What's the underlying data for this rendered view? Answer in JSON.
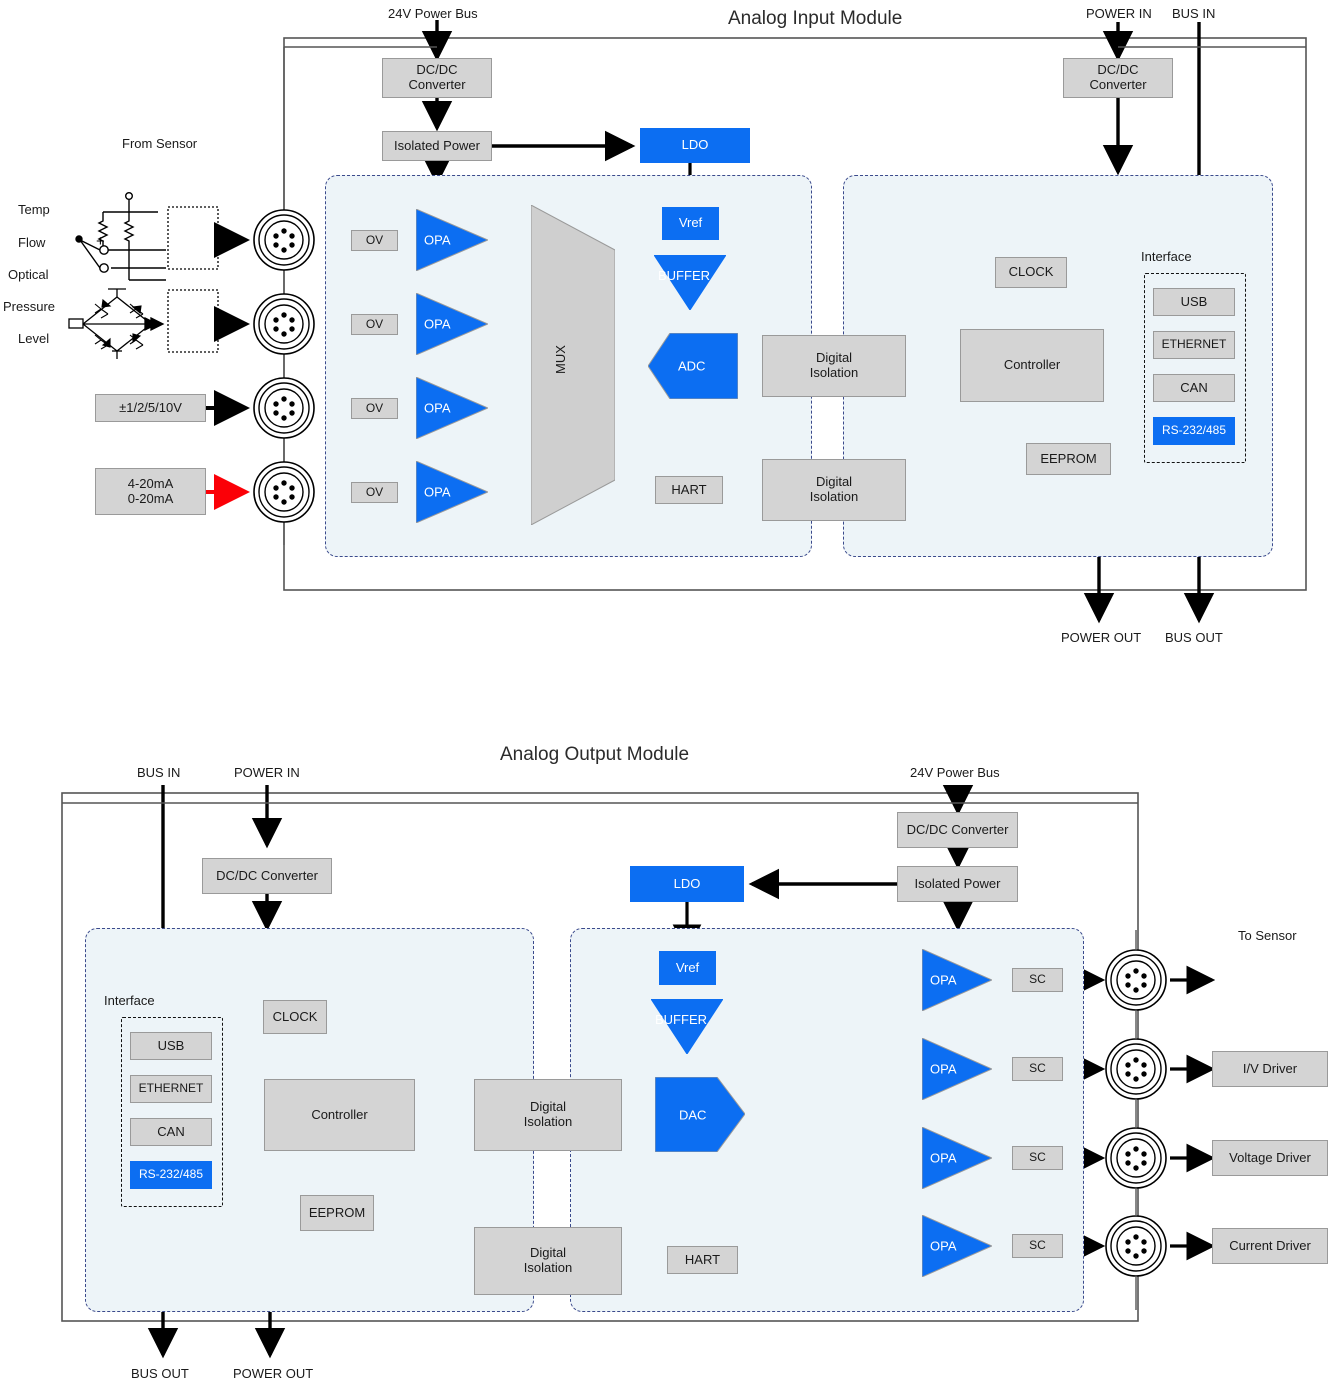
{
  "modules": {
    "input": {
      "title": "Analog Input Module",
      "power_bus_label": "24V Power Bus",
      "power_in_label": "POWER IN",
      "bus_in_label": "BUS IN",
      "power_out_label": "POWER OUT",
      "bus_out_label": "BUS OUT",
      "from_sensor_label": "From Sensor",
      "sensor_types": [
        "Temp",
        "Flow",
        "Optical",
        "Pressure",
        "Level"
      ],
      "signal_boxes": [
        {
          "label": "±1/2/5/10V"
        },
        {
          "line1": "4-20mA",
          "line2": "0-20mA"
        }
      ],
      "dcdc_left": "DC/DC\nConverter",
      "dcdc_left_l1": "DC/DC",
      "dcdc_left_l2": "Converter",
      "isolated_power": "Isolated Power",
      "ldo": "LDO",
      "vref": "Vref",
      "buffer": "BUFFER",
      "adc": "ADC",
      "mux": "MUX",
      "hart": "HART",
      "ov": "OV",
      "opa": "OPA",
      "digital_isolation_l1": "Digital",
      "digital_isolation_l2": "Isolation",
      "controller": "Controller",
      "clock": "CLOCK",
      "eeprom": "EEPROM",
      "interface_label": "Interface",
      "interface_items": [
        "USB",
        "ETHERNET",
        "CAN",
        "RS-232/485"
      ],
      "dcdc_right_l1": "DC/DC",
      "dcdc_right_l2": "Converter"
    },
    "output": {
      "title": "Analog Output Module",
      "bus_in_label": "BUS IN",
      "power_in_label": "POWER IN",
      "bus_out_label": "BUS OUT",
      "power_out_label": "POWER OUT",
      "power_bus_label": "24V Power Bus",
      "to_sensor_label": "To Sensor",
      "dcdc_left": "DC/DC Converter",
      "dcdc_right": "DC/DC Converter",
      "isolated_power": "Isolated Power",
      "ldo": "LDO",
      "vref": "Vref",
      "buffer": "BUFFER",
      "dac": "DAC",
      "hart": "HART",
      "opa": "OPA",
      "sc": "SC",
      "digital_isolation_l1": "Digital",
      "digital_isolation_l2": "Isolation",
      "controller": "Controller",
      "clock": "CLOCK",
      "eeprom": "EEPROM",
      "interface_label": "Interface",
      "interface_items": [
        "USB",
        "ETHERNET",
        "CAN",
        "RS-232/485"
      ],
      "drivers": [
        "I/V Driver",
        "Voltage Driver",
        "Current Driver"
      ]
    }
  },
  "colors": {
    "accent_blue": "#0c6ef2",
    "grey_box": "#d4d4d4",
    "region_fill": "#edf4f8",
    "region_border": "#3b4a8c",
    "signal_red": "#fb0007",
    "line_black": "#000000"
  }
}
